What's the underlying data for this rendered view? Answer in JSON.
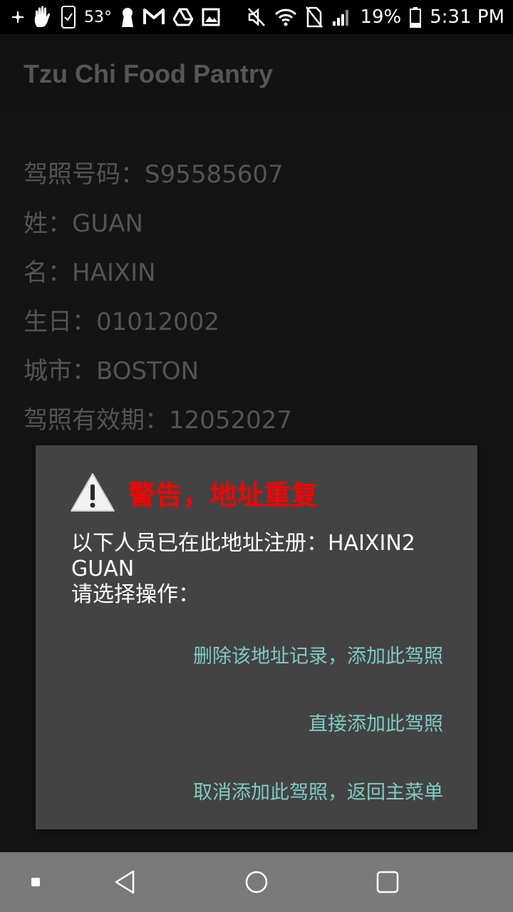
{
  "status_bar": {
    "temperature": "53°",
    "battery": "19%",
    "time": "5:31 PM",
    "left_icons": [
      "notification-dot-icon",
      "hand-icon",
      "phone-check-icon",
      "keyhole-icon",
      "gmail-icon",
      "drive-icon",
      "image-icon"
    ],
    "right_icons": [
      "mute-icon",
      "wifi-icon",
      "no-sim-icon",
      "signal-icon",
      "battery-icon"
    ]
  },
  "app_bar": {
    "title": "Tzu Chi Food Pantry"
  },
  "fields": {
    "license": "驾照号码：S95585607",
    "last_name": "姓：GUAN",
    "first_name": "名：HAIXIN",
    "birthday": "生日：01012002",
    "city": "城市：BOSTON",
    "expiry": "驾照有效期：12052027"
  },
  "dialog": {
    "icon": "warning-icon",
    "title": "警告，地址重复",
    "message": "以下人员已在此地址注册：HAIXIN2\nGUAN\n请选择操作：",
    "buttons": {
      "delete_and_add": "删除该地址记录，添加此驾照",
      "add_directly": "直接添加此驾照",
      "cancel": "取消添加此驾照，返回主菜单"
    }
  },
  "nav_bar": {
    "icons": [
      "recents-dot-icon",
      "back-icon",
      "home-icon",
      "overview-icon"
    ]
  }
}
